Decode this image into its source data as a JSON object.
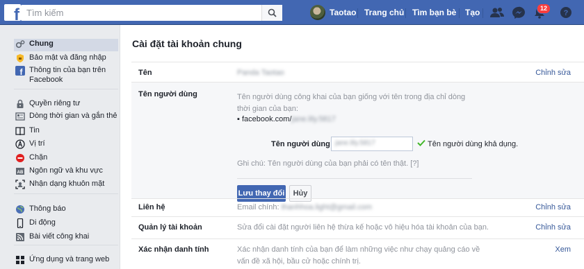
{
  "topbar": {
    "search_placeholder": "Tìm kiếm",
    "user_name": "Taotao",
    "nav": [
      "Trang chủ",
      "Tìm bạn bè",
      "Tạo"
    ],
    "notification_count": "12"
  },
  "sidebar": {
    "groups": [
      [
        {
          "label": "Chung",
          "icon": "gears-icon",
          "active": true
        },
        {
          "label": "Bảo mật và đăng nhập",
          "icon": "shield-icon"
        },
        {
          "label": "Thông tin của bạn trên Facebook",
          "icon": "facebook-icon"
        }
      ],
      [
        {
          "label": "Quyền riêng tư",
          "icon": "lock-icon"
        },
        {
          "label": "Dòng thời gian và gắn thẻ",
          "icon": "timeline-icon"
        },
        {
          "label": "Tin",
          "icon": "book-icon"
        },
        {
          "label": "Vị trí",
          "icon": "location-icon"
        },
        {
          "label": "Chặn",
          "icon": "block-icon"
        },
        {
          "label": "Ngôn ngữ và khu vực",
          "icon": "language-icon"
        },
        {
          "label": "Nhận dạng khuôn mặt",
          "icon": "face-recognition-icon"
        }
      ],
      [
        {
          "label": "Thông báo",
          "icon": "globe-icon"
        },
        {
          "label": "Di động",
          "icon": "mobile-icon"
        },
        {
          "label": "Bài viết công khai",
          "icon": "rss-icon"
        }
      ],
      [
        {
          "label": "Ứng dụng và trang web",
          "icon": "apps-icon"
        }
      ]
    ]
  },
  "main": {
    "title": "Cài đặt tài khoản chung",
    "name_row": {
      "label": "Tên",
      "value": "Panda Taotao",
      "action": "Chỉnh sửa"
    },
    "username_row": {
      "label": "Tên người dùng",
      "description": "Tên người dùng công khai của bạn giống với tên trong địa chỉ dòng thời gian của bạn:",
      "url_prefix": "facebook.com/",
      "url_handle": "jane.lily.5817",
      "field_label": "Tên người dùng",
      "field_value": "jane.lily.5817",
      "availability": "Tên người dùng khả dụng.",
      "note": "Ghi chú: Tên người dùng của bạn phải có tên thật. [?]",
      "save": "Lưu thay đổi",
      "cancel": "Hủy"
    },
    "contact_row": {
      "label": "Liên hệ",
      "prefix": "Email chính:",
      "value": "thanhhoa.light@gmail.com",
      "action": "Chỉnh sửa"
    },
    "account_row": {
      "label": "Quản lý tài khoản",
      "value": "Sửa đổi cài đặt người liên hệ thừa kế hoặc vô hiệu hóa tài khoản của bạn.",
      "action": "Chỉnh sửa"
    },
    "identity_row": {
      "label": "Xác nhận danh tính",
      "value": "Xác nhận danh tính của bạn để làm những việc như chạy quảng cáo về vấn đề xã hội, bầu cử hoặc chính trị.",
      "action": "Xem"
    }
  }
}
